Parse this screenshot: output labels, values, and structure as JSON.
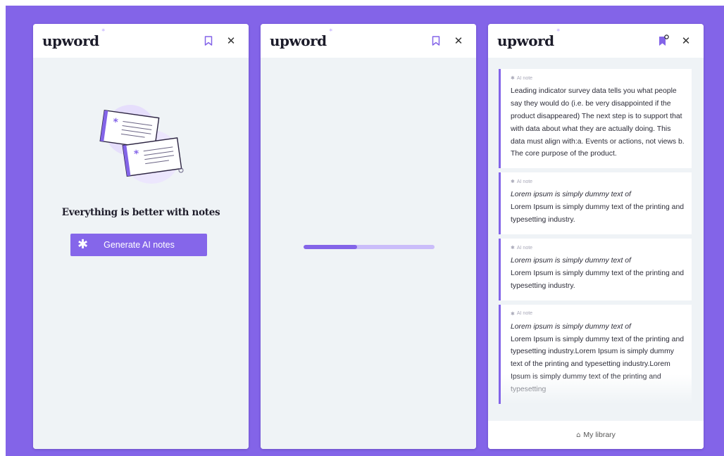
{
  "brand": {
    "name": "upword",
    "star": "*"
  },
  "colors": {
    "accent": "#8364E8",
    "background": "#8364E8",
    "panel_bg": "#EFF3F6",
    "progress_track": "#CABDFA"
  },
  "panels": [
    {
      "id": "empty",
      "empty_state": {
        "title": "Everything is better with notes",
        "button_label": "Generate AI notes",
        "button_icon": "asterisk-icon"
      }
    },
    {
      "id": "loading",
      "progress": 0.41
    },
    {
      "id": "notes",
      "notes": [
        {
          "tag": "AI note",
          "italic_line": "",
          "text": "Leading indicator survey data tells you what people say they would do (i.e. be very disappointed if the product disappeared) The next step is to support that with data about what they are actually doing. This data must align with:a. Events or actions, not views b. The core purpose of the product."
        },
        {
          "tag": "AI note",
          "italic_line": "Lorem ipsum is simply dummy text of",
          "text": "Lorem Ipsum is simply dummy text of the printing and typesetting industry."
        },
        {
          "tag": "AI note",
          "italic_line": "Lorem ipsum is simply dummy text of",
          "text": "Lorem Ipsum is simply dummy text of the printing and typesetting industry."
        },
        {
          "tag": "AI note",
          "italic_line": "Lorem ipsum is simply dummy text of",
          "text": "Lorem Ipsum is simply dummy text of the printing and typesetting industry.Lorem Ipsum is simply dummy text of the printing and typesetting industry.Lorem Ipsum is simply dummy text of the printing and typesetting"
        }
      ],
      "footer_label": "My library",
      "footer_icon": "library-icon"
    }
  ]
}
